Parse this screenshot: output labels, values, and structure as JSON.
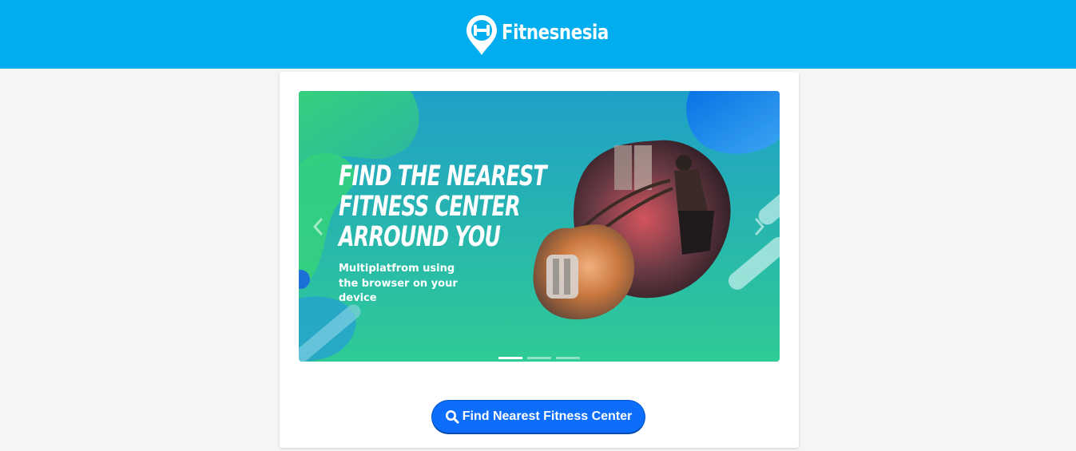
{
  "header": {
    "brand_name": "Fitnesnesia",
    "logo_icon": "location-pin-dumbbell-icon",
    "background_color": "#00adef"
  },
  "carousel": {
    "slides": [
      {
        "headline_lines": [
          "FIND  THE NEAREST",
          "FITNESS CENTER",
          "ARROUND YOU"
        ],
        "subtext": "Multiplatfrom using the browser on your device"
      }
    ],
    "active_index": 0,
    "indicator_count": 3,
    "prev_icon": "chevron-left-icon",
    "next_icon": "chevron-right-icon"
  },
  "actions": {
    "find_button_label": "Find Nearest Fitness Center",
    "find_button_icon": "search-icon",
    "accent_color": "#0d6efd"
  }
}
